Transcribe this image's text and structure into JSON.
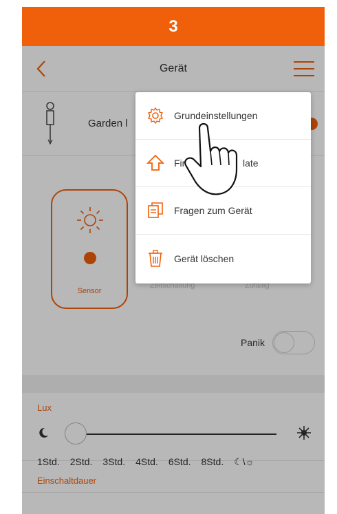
{
  "step": {
    "number": "3"
  },
  "nav": {
    "title": "Gerät",
    "back_icon": "chevron-left-icon",
    "menu_icon": "hamburger-menu-icon"
  },
  "device": {
    "name": "Garden l",
    "icon": "garden-light-icon"
  },
  "modes": [
    {
      "label": "Sensor",
      "icon": "sun-icon",
      "active": true
    },
    {
      "label": "Zeitschaltung",
      "active": false
    },
    {
      "label": "Zufällig",
      "active": false
    }
  ],
  "panic": {
    "label": "Panik",
    "enabled": false
  },
  "lux": {
    "label": "Lux",
    "level": 0.02
  },
  "duration": {
    "label": "Einschaltdauer",
    "options": [
      "1Std.",
      "2Std.",
      "3Std.",
      "4Std.",
      "6Std.",
      "8Std.",
      "☾\\☼"
    ]
  },
  "dropdown": {
    "items": [
      {
        "label": "Grundeinstellungen",
        "icon": "gear-icon"
      },
      {
        "label": "Firmware Update",
        "visible_label_start": "Firm",
        "visible_label_end": "late",
        "icon": "upload-arrow-icon"
      },
      {
        "label": "Fragen zum Gerät",
        "icon": "document-icon"
      },
      {
        "label": "Gerät löschen",
        "icon": "trash-icon"
      }
    ]
  },
  "colors": {
    "accent": "#f05f0a",
    "text": "#333333",
    "overlay": "rgba(0,0,0,0.28)"
  }
}
